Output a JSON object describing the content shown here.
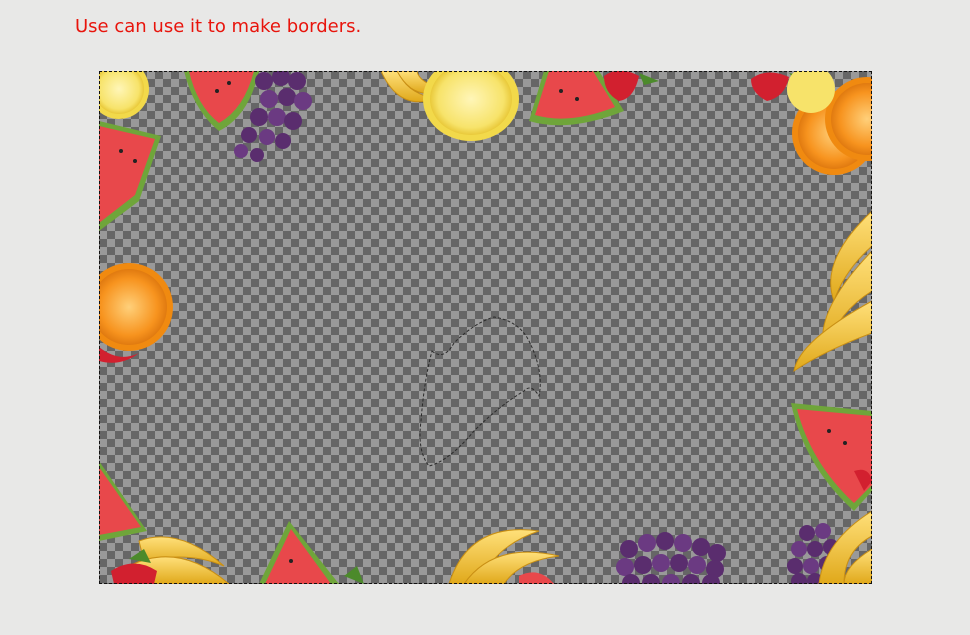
{
  "caption": "Use can use it to make borders.",
  "canvas": {
    "background": "transparency-checkerboard",
    "items": [
      "lemon-slice",
      "watermelon-slice",
      "grapes",
      "bananas",
      "lemon-slice",
      "watermelon-slice",
      "strawberry",
      "orange-slices",
      "watermelon-slice",
      "orange-slice",
      "bananas",
      "watermelon-slice",
      "watermelon-slice",
      "bananas",
      "strawberry",
      "watermelon-slice",
      "bananas",
      "grapes",
      "grapes",
      "bananas"
    ],
    "selection": "lasso-selection"
  },
  "colors": {
    "caption": "#e8140c",
    "checker_light": "#999999",
    "checker_dark": "#666666",
    "watermelon_flesh": "#e8484b",
    "watermelon_rind": "#6fa53a",
    "banana": "#f2c42a",
    "orange": "#f7931e",
    "lemon": "#f7e36a",
    "grape": "#5a2d6e",
    "strawberry": "#d2202f"
  }
}
